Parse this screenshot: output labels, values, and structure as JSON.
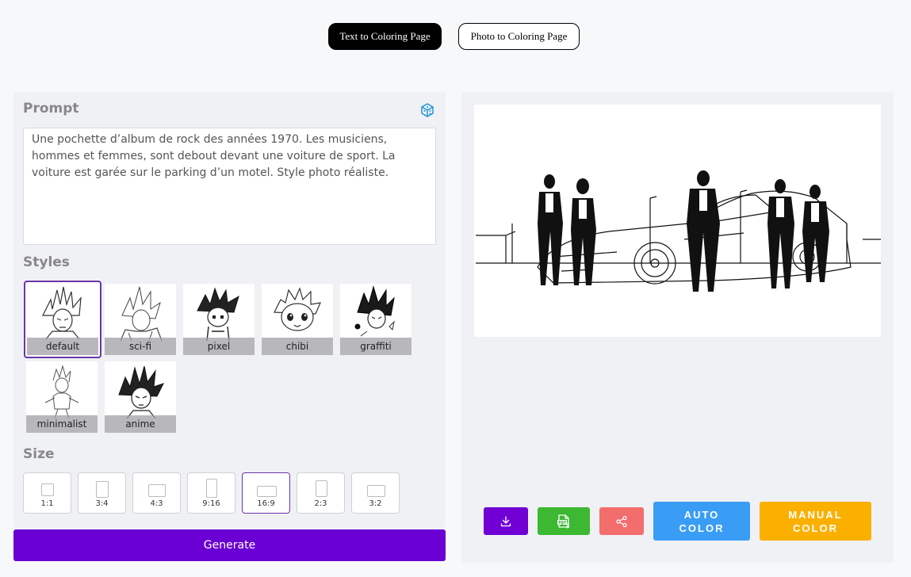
{
  "tabs": {
    "text_to_coloring": "Text to Coloring Page",
    "photo_to_coloring": "Photo to Coloring Page"
  },
  "prompt": {
    "title": "Prompt",
    "text": "Une pochette d’album de rock des années 1970. Les musiciens, hommes et femmes, sont debout devant une voiture de sport. La voiture est garée sur le parking d’un motel. Style photo réaliste."
  },
  "styles": {
    "title": "Styles",
    "items": [
      {
        "label": "default",
        "selected": true
      },
      {
        "label": "sci-fi",
        "selected": false
      },
      {
        "label": "pixel",
        "selected": false
      },
      {
        "label": "chibi",
        "selected": false
      },
      {
        "label": "graffiti",
        "selected": false
      },
      {
        "label": "minimalist",
        "selected": false
      },
      {
        "label": "anime",
        "selected": false
      }
    ]
  },
  "size": {
    "title": "Size",
    "options": [
      {
        "label": "1:1",
        "selected": false
      },
      {
        "label": "3:4",
        "selected": false
      },
      {
        "label": "4:3",
        "selected": false
      },
      {
        "label": "9:16",
        "selected": false
      },
      {
        "label": "16:9",
        "selected": true
      },
      {
        "label": "2:3",
        "selected": false
      },
      {
        "label": "3:2",
        "selected": false
      }
    ]
  },
  "generate_label": "Generate",
  "actions": {
    "auto_color": "AUTO COLOR",
    "manual_color": "MANUAL COLOR"
  },
  "icons": {
    "random": "dice-icon",
    "download": "download-icon",
    "pdf": "pdf-download-icon",
    "share": "share-icon"
  },
  "colors": {
    "primary": "#6a00d4",
    "selected_border": "#6b35a8",
    "pdf_green": "#3cb832",
    "share_red": "#f36d6d",
    "auto_blue": "#3a9df5",
    "manual_yellow": "#fbb000"
  }
}
